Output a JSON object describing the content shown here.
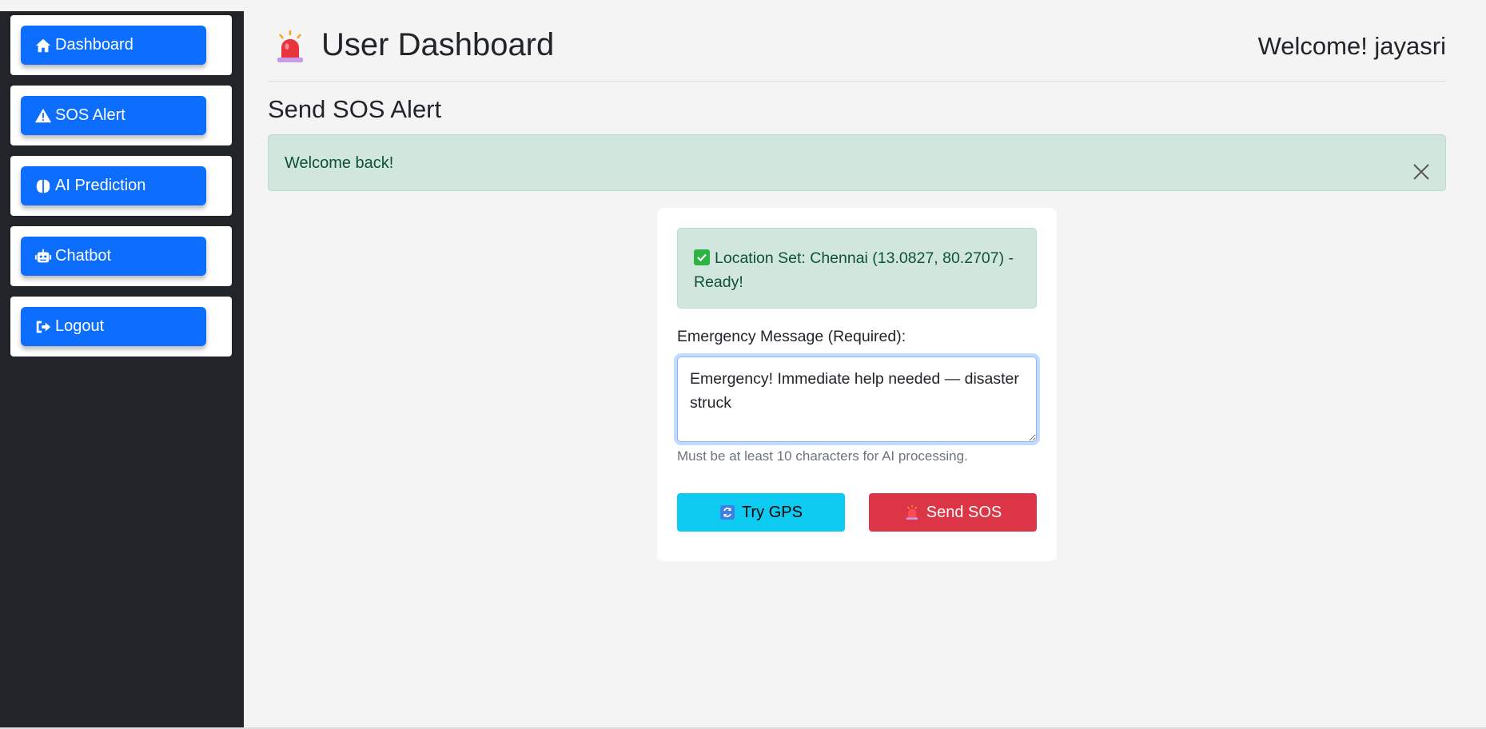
{
  "sidebar": {
    "items": [
      {
        "label": "Dashboard",
        "icon": "home-icon"
      },
      {
        "label": "SOS Alert",
        "icon": "warning-triangle-icon"
      },
      {
        "label": "AI Prediction",
        "icon": "brain-icon"
      },
      {
        "label": "Chatbot",
        "icon": "robot-icon"
      },
      {
        "label": "Logout",
        "icon": "logout-icon"
      }
    ]
  },
  "header": {
    "title": "User Dashboard",
    "icon": "siren-icon",
    "welcome": "Welcome! jayasri"
  },
  "page": {
    "section_title": "Send SOS Alert"
  },
  "alert": {
    "message": "Welcome back!",
    "close_icon": "close-icon"
  },
  "form": {
    "location_status": "Location Set: Chennai (13.0827, 80.2707) - Ready!",
    "location_icon": "check-mark-icon",
    "message_label": "Emergency Message (Required):",
    "message_value": "Emergency! Immediate help needed — disaster struck",
    "hint": "Must be at least 10 characters for AI processing.",
    "gps_button": "Try GPS",
    "gps_icon": "refresh-icon",
    "sos_button": "Send SOS",
    "sos_icon": "siren-icon"
  },
  "colors": {
    "primary": "#0d6efd",
    "sidebar_bg": "#212529",
    "success_bg": "#d1e7dd",
    "success_text": "#0f5132",
    "info": "#0dcaf0",
    "danger": "#dc3545"
  }
}
